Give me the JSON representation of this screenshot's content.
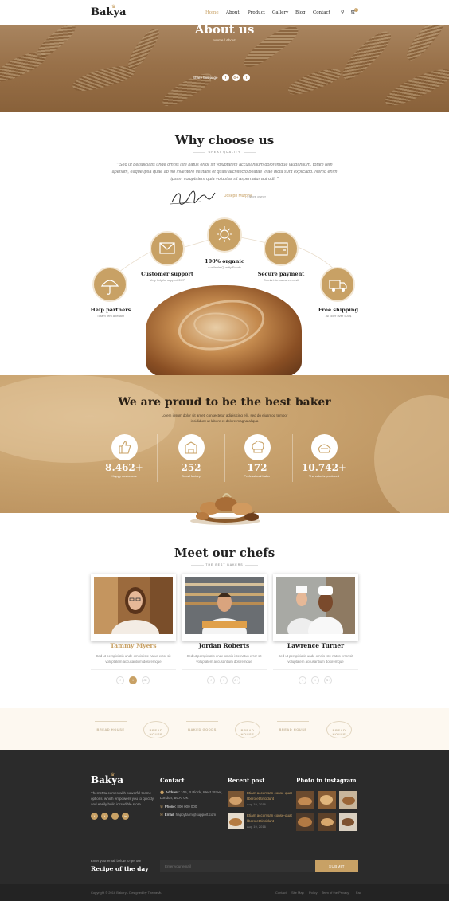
{
  "brand": {
    "logo": "Bakya"
  },
  "nav": {
    "items": [
      "Home",
      "About",
      "Product",
      "Gallery",
      "Blog",
      "Contact"
    ],
    "active": "Home",
    "cart_count": "0"
  },
  "hero": {
    "title": "About us",
    "breadcrumb": "Home  /  About",
    "share_label": "Share this page",
    "share_icons": [
      "f",
      "G+",
      "t"
    ]
  },
  "why": {
    "title": "Why choose us",
    "subtitle": "GREAT QUALITY",
    "quote": "\" Sed ut perspiciatis unde omnis iste natus error sit voluptatem accusantium doloremque laudantium, totam rem aperiam, eaque ipsa quae ab illo inventore veritatis et quasi architecto beatae vitae dicta sunt explicabo. Nemo enim ipsam voluptatem quia voluptas sit aspernatur aut odit \"",
    "author": "Joseph Murphy",
    "author_role": "- Store owner"
  },
  "features": [
    {
      "title": "Help partners",
      "desc": "Totam rem aperiam",
      "icon": "umbrella-icon"
    },
    {
      "title": "Customer support",
      "desc": "Very helpful support 24/7",
      "icon": "mail-icon"
    },
    {
      "title": "100% organic",
      "desc": "Available Quality Foods",
      "icon": "sun-icon"
    },
    {
      "title": "Secure payment",
      "desc": "Omnis iste natus error sit",
      "icon": "wallet-icon"
    },
    {
      "title": "Free shipping",
      "desc": "All oder over 500$",
      "icon": "truck-icon"
    }
  ],
  "proud": {
    "title": "We are proud to be the best baker",
    "desc": "Lorem ipsum dolor sit amet, consectetur adipisicing elit, sed do eiusmod tempor incididunt ut labore et dolore magna aliqua",
    "stats": [
      {
        "number": "8.462+",
        "label": "Happy customers",
        "icon": "thumbs-up-icon"
      },
      {
        "number": "252",
        "label": "Bread factory",
        "icon": "factory-icon"
      },
      {
        "number": "172",
        "label": "Professional baker",
        "icon": "chef-hat-icon"
      },
      {
        "number": "10.742+",
        "label": "The cake is produced",
        "icon": "cake-icon"
      }
    ]
  },
  "chefs": {
    "title": "Meet our chefs",
    "subtitle": "THE BEST BAKERS",
    "list": [
      {
        "name": "Tammy Myers",
        "desc": "Sed ut perspiciatis unde omnis iste natus error sit voluptatem accusantium doloremque"
      },
      {
        "name": "Jordan Roberts",
        "desc": "Sed ut perspiciatis unde omnis iste natus error sit voluptatem accusantium doloremque"
      },
      {
        "name": "Lawrence Turner",
        "desc": "Sed ut perspiciatis unde omnis iste natus error sit voluptatem accusantium doloremque"
      }
    ],
    "social": [
      "f",
      "t",
      "G+"
    ]
  },
  "brands": [
    "BREAD HOUSE",
    "BREAD HOUSE",
    "BAKED GOODS",
    "BREAD HOUSE",
    "BREAD HOUSE",
    "BREAD HOUSE"
  ],
  "footer": {
    "logo": "Bakya",
    "about": "ThemeMu comes with powerful theme options, which empowers you to quickly and easily build incredible store.",
    "social": [
      "f",
      "t",
      "t",
      "in"
    ],
    "contact_head": "Contact",
    "address_label": "Address:",
    "address": "105, B Block, West Street, London, BCA, UK",
    "phone_label": "Phone:",
    "phone": "800 000 000",
    "email_label": "Email:",
    "email": "happyfarm@support.com",
    "recent_head": "Recent post",
    "posts": [
      {
        "title": "Etiam accumsan conse-quat libero et tincidunt",
        "date": "Aug 19, 2016"
      },
      {
        "title": "Etiam accumsan conse-quat libero et tincidunt",
        "date": "Aug 19, 2016"
      }
    ],
    "insta_head": "Photo in instagram",
    "recipe_label": "Enter your email below to get our",
    "recipe_title": "Recipe of the day",
    "email_placeholder": "Enter your email",
    "submit": "SUBMIT",
    "copyright": "Copyright © 2016 Bakery - Designed by ThemeMu",
    "links": [
      "Contact",
      "Site Map",
      "Policy",
      "Term of the Privacy",
      "Faq"
    ]
  },
  "colors": {
    "accent": "#c8a165",
    "dark": "#2b2b2b",
    "cream": "#fdf8f0"
  }
}
